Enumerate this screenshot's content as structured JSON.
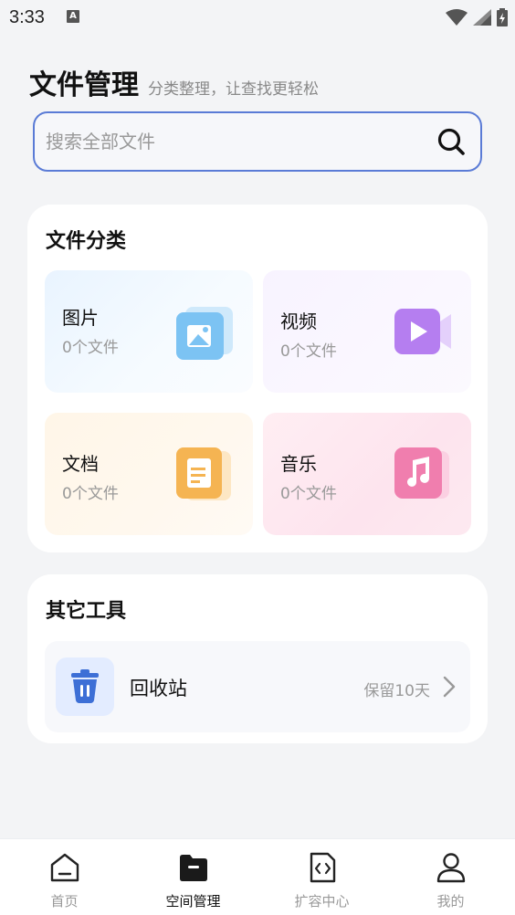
{
  "status_bar": {
    "time": "3:33",
    "notification_letter": "A"
  },
  "header": {
    "title": "文件管理",
    "subtitle": "分类整理，让查找更轻松"
  },
  "search": {
    "placeholder": "搜索全部文件",
    "value": ""
  },
  "categories": {
    "title": "文件分类",
    "items": [
      {
        "name": "图片",
        "count": "0个文件",
        "icon": "image-icon",
        "color": "#7cc3f3"
      },
      {
        "name": "视频",
        "count": "0个文件",
        "icon": "video-icon",
        "color": "#b57ef0"
      },
      {
        "name": "文档",
        "count": "0个文件",
        "icon": "document-icon",
        "color": "#f5b452"
      },
      {
        "name": "音乐",
        "count": "0个文件",
        "icon": "music-icon",
        "color": "#f07eae"
      }
    ]
  },
  "tools": {
    "title": "其它工具",
    "items": [
      {
        "label": "回收站",
        "meta": "保留10天",
        "icon": "trash-icon",
        "color": "#3d6fd6"
      }
    ]
  },
  "tab_bar": {
    "active": 1,
    "tabs": [
      {
        "label": "首页",
        "icon": "home-icon"
      },
      {
        "label": "空间管理",
        "icon": "folder-icon"
      },
      {
        "label": "扩容中心",
        "icon": "code-file-icon"
      },
      {
        "label": "我的",
        "icon": "user-icon"
      }
    ]
  }
}
